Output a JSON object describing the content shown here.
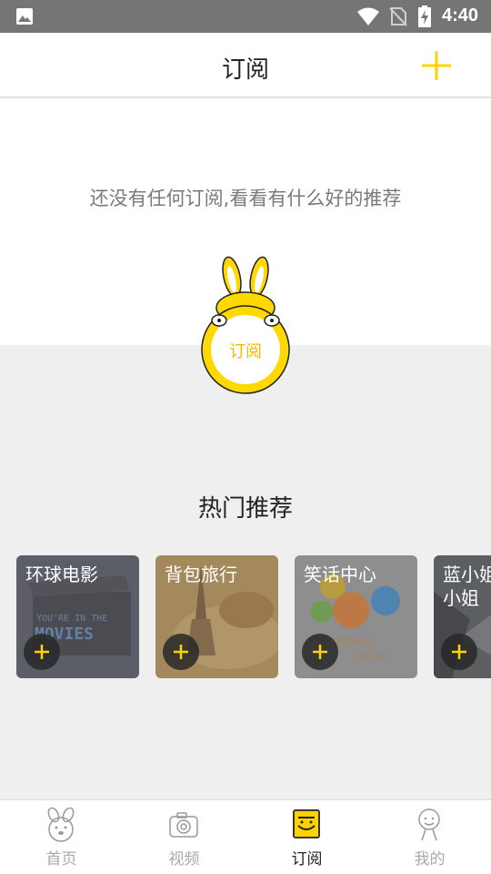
{
  "status_bar": {
    "time": "4:40",
    "icons": [
      "image-icon",
      "wifi-icon",
      "no-sim-icon",
      "battery-charging-icon"
    ]
  },
  "header": {
    "title": "订阅",
    "add_icon": "plus-icon"
  },
  "empty_state": {
    "message": "还没有任何订阅,看看有什么好的推荐",
    "mascot_label": "订阅"
  },
  "hot": {
    "title": "热门推荐",
    "cards": [
      {
        "name": "环球电影",
        "bg": "#3a3f4a",
        "image_text": "YOU'RE IN THE MOVIES"
      },
      {
        "name": "背包旅行",
        "bg": "#a8804a",
        "image_text": ""
      },
      {
        "name": "笑话中心",
        "bg": "#8a8a8a",
        "image_text": "笑话中心 Center"
      },
      {
        "name": "蓝小姐小姐",
        "bg": "#55585c",
        "image_text": ""
      }
    ]
  },
  "bottom_nav": {
    "items": [
      {
        "label": "首页",
        "icon": "bunny-home-icon",
        "active": false
      },
      {
        "label": "视频",
        "icon": "camera-icon",
        "active": false
      },
      {
        "label": "订阅",
        "icon": "subscription-icon",
        "active": true
      },
      {
        "label": "我的",
        "icon": "person-icon",
        "active": false
      }
    ]
  },
  "colors": {
    "accent": "#ffd200",
    "status_bar": "#757575",
    "page_bg": "#efefef"
  }
}
